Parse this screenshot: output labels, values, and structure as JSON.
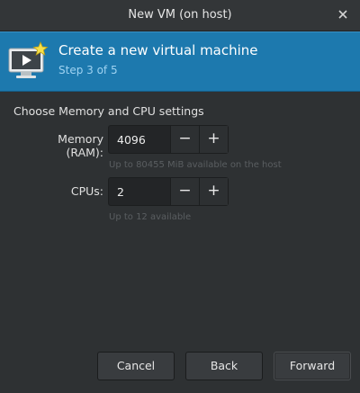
{
  "window": {
    "title": "New VM (on host)",
    "close_icon": "close-icon"
  },
  "banner": {
    "title": "Create a new virtual machine",
    "step": "Step 3 of 5",
    "icon": "new-vm-icon",
    "colors": {
      "background": "#1d79ae",
      "step_text": "#9fd3f2"
    }
  },
  "section": {
    "heading": "Choose Memory and CPU settings"
  },
  "memory": {
    "label": "Memory (RAM):",
    "value": "4096",
    "decrement": "−",
    "increment": "+",
    "hint": "Up to 80455 MiB available on the host"
  },
  "cpus": {
    "label": "CPUs:",
    "value": "2",
    "decrement": "−",
    "increment": "+",
    "hint": "Up to 12 available"
  },
  "buttons": {
    "cancel": "Cancel",
    "back": "Back",
    "forward": "Forward"
  }
}
